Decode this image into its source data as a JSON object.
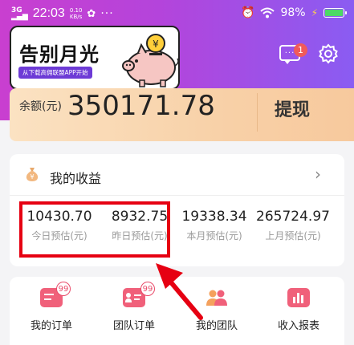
{
  "status_bar": {
    "signal": "3G",
    "time": "22:03",
    "speed_value": "0.10",
    "speed_unit": "KB/s",
    "wechat_symbol": "✿",
    "more": "···",
    "alarm_symbol": "⏰",
    "wifi_symbol": "◔",
    "battery_percent": "98%",
    "battery_level": 0.98
  },
  "banner": {
    "title": "告别月光",
    "subtitle": "从下载高佣联盟APP开始"
  },
  "header": {
    "message_icon_text": "···",
    "message_badge": "1"
  },
  "balance": {
    "label": "余额(元)",
    "value": "350171.78",
    "withdraw_label": "提现"
  },
  "earnings": {
    "title": "我的收益",
    "chevron": "›",
    "stats": [
      {
        "value": "10430.70",
        "label": "今日预估(元)"
      },
      {
        "value": "8932.75",
        "label": "昨日预估(元)"
      },
      {
        "value": "19338.34",
        "label": "本月预估(元)"
      },
      {
        "value": "265724.97",
        "label": "上月预估(元)"
      }
    ]
  },
  "functions": [
    {
      "label": "我的订单",
      "badge": "99"
    },
    {
      "label": "团队订单",
      "badge": "99"
    },
    {
      "label": "我的团队",
      "badge": ""
    },
    {
      "label": "收入报表",
      "badge": ""
    }
  ],
  "colors": {
    "header_gradient_start": "#c93fd0",
    "header_gradient_end": "#8a5cf2",
    "highlight_red": "#e60012",
    "icon_pink": "#f0607a",
    "badge_red": "#f05a5a"
  },
  "icons": {
    "message": "message-icon",
    "settings": "gear-icon",
    "earnings": "moneybag-icon",
    "my_orders": "order-icon",
    "team_orders": "team-order-icon",
    "my_team": "team-icon",
    "income_report": "report-icon"
  }
}
